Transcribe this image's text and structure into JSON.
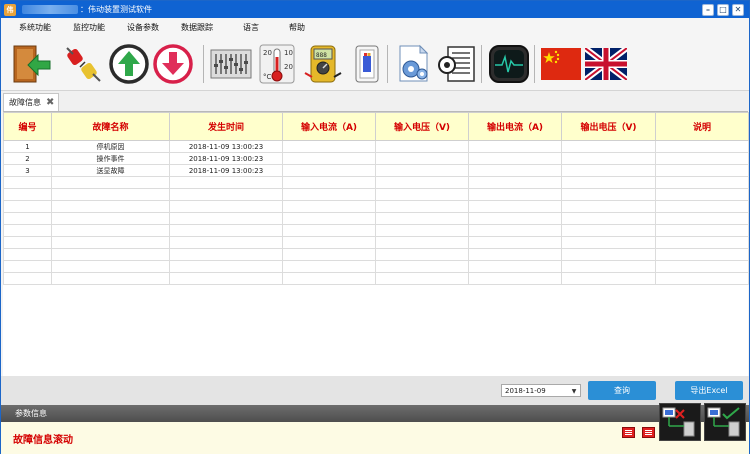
{
  "window": {
    "title": "：伟动装置测试软件",
    "app_icon_text": "伟"
  },
  "menu": [
    "系统功能",
    "监控功能",
    "设备参数",
    "数据跟踪",
    "语言",
    "帮助"
  ],
  "toolbar_icons": [
    "exit-door-icon",
    "disconnect-plug-icon",
    "upload-arrow-icon",
    "download-arrow-icon",
    "equalizer-sliders-icon",
    "thermometer-icon",
    "multimeter-icon",
    "device-unit-icon",
    "document-settings-icon",
    "chip-settings-icon",
    "oscilloscope-icon",
    "chinese-flag-icon",
    "uk-flag-icon"
  ],
  "tab": {
    "label": "故障信息"
  },
  "grid": {
    "columns": [
      "编号",
      "故障名称",
      "发生时间",
      "输入电流（A)",
      "输入电压（V)",
      "输出电流（A)",
      "输出电压（V)",
      "说明"
    ],
    "rows": [
      [
        "1",
        "停机原因",
        "2018-11-09 13:00:23",
        "",
        "",
        "",
        "",
        ""
      ],
      [
        "2",
        "操作事件",
        "2018-11-09 13:00:23",
        "",
        "",
        "",
        "",
        ""
      ],
      [
        "3",
        "送显故障",
        "2018-11-09 13:00:23",
        "",
        "",
        "",
        "",
        ""
      ]
    ]
  },
  "query": {
    "date_value": "2018-11-09",
    "query_label": "查询",
    "export_label": "导出Excel"
  },
  "params": {
    "label": "参数信息"
  },
  "status": {
    "scroll_message": "故障信息滚动"
  },
  "colors": {
    "titlebar": "#0f63d2",
    "header_bg": "#ffffcc",
    "header_text": "#d40000",
    "button": "#2b8fd6",
    "status_red": "#d40000"
  }
}
